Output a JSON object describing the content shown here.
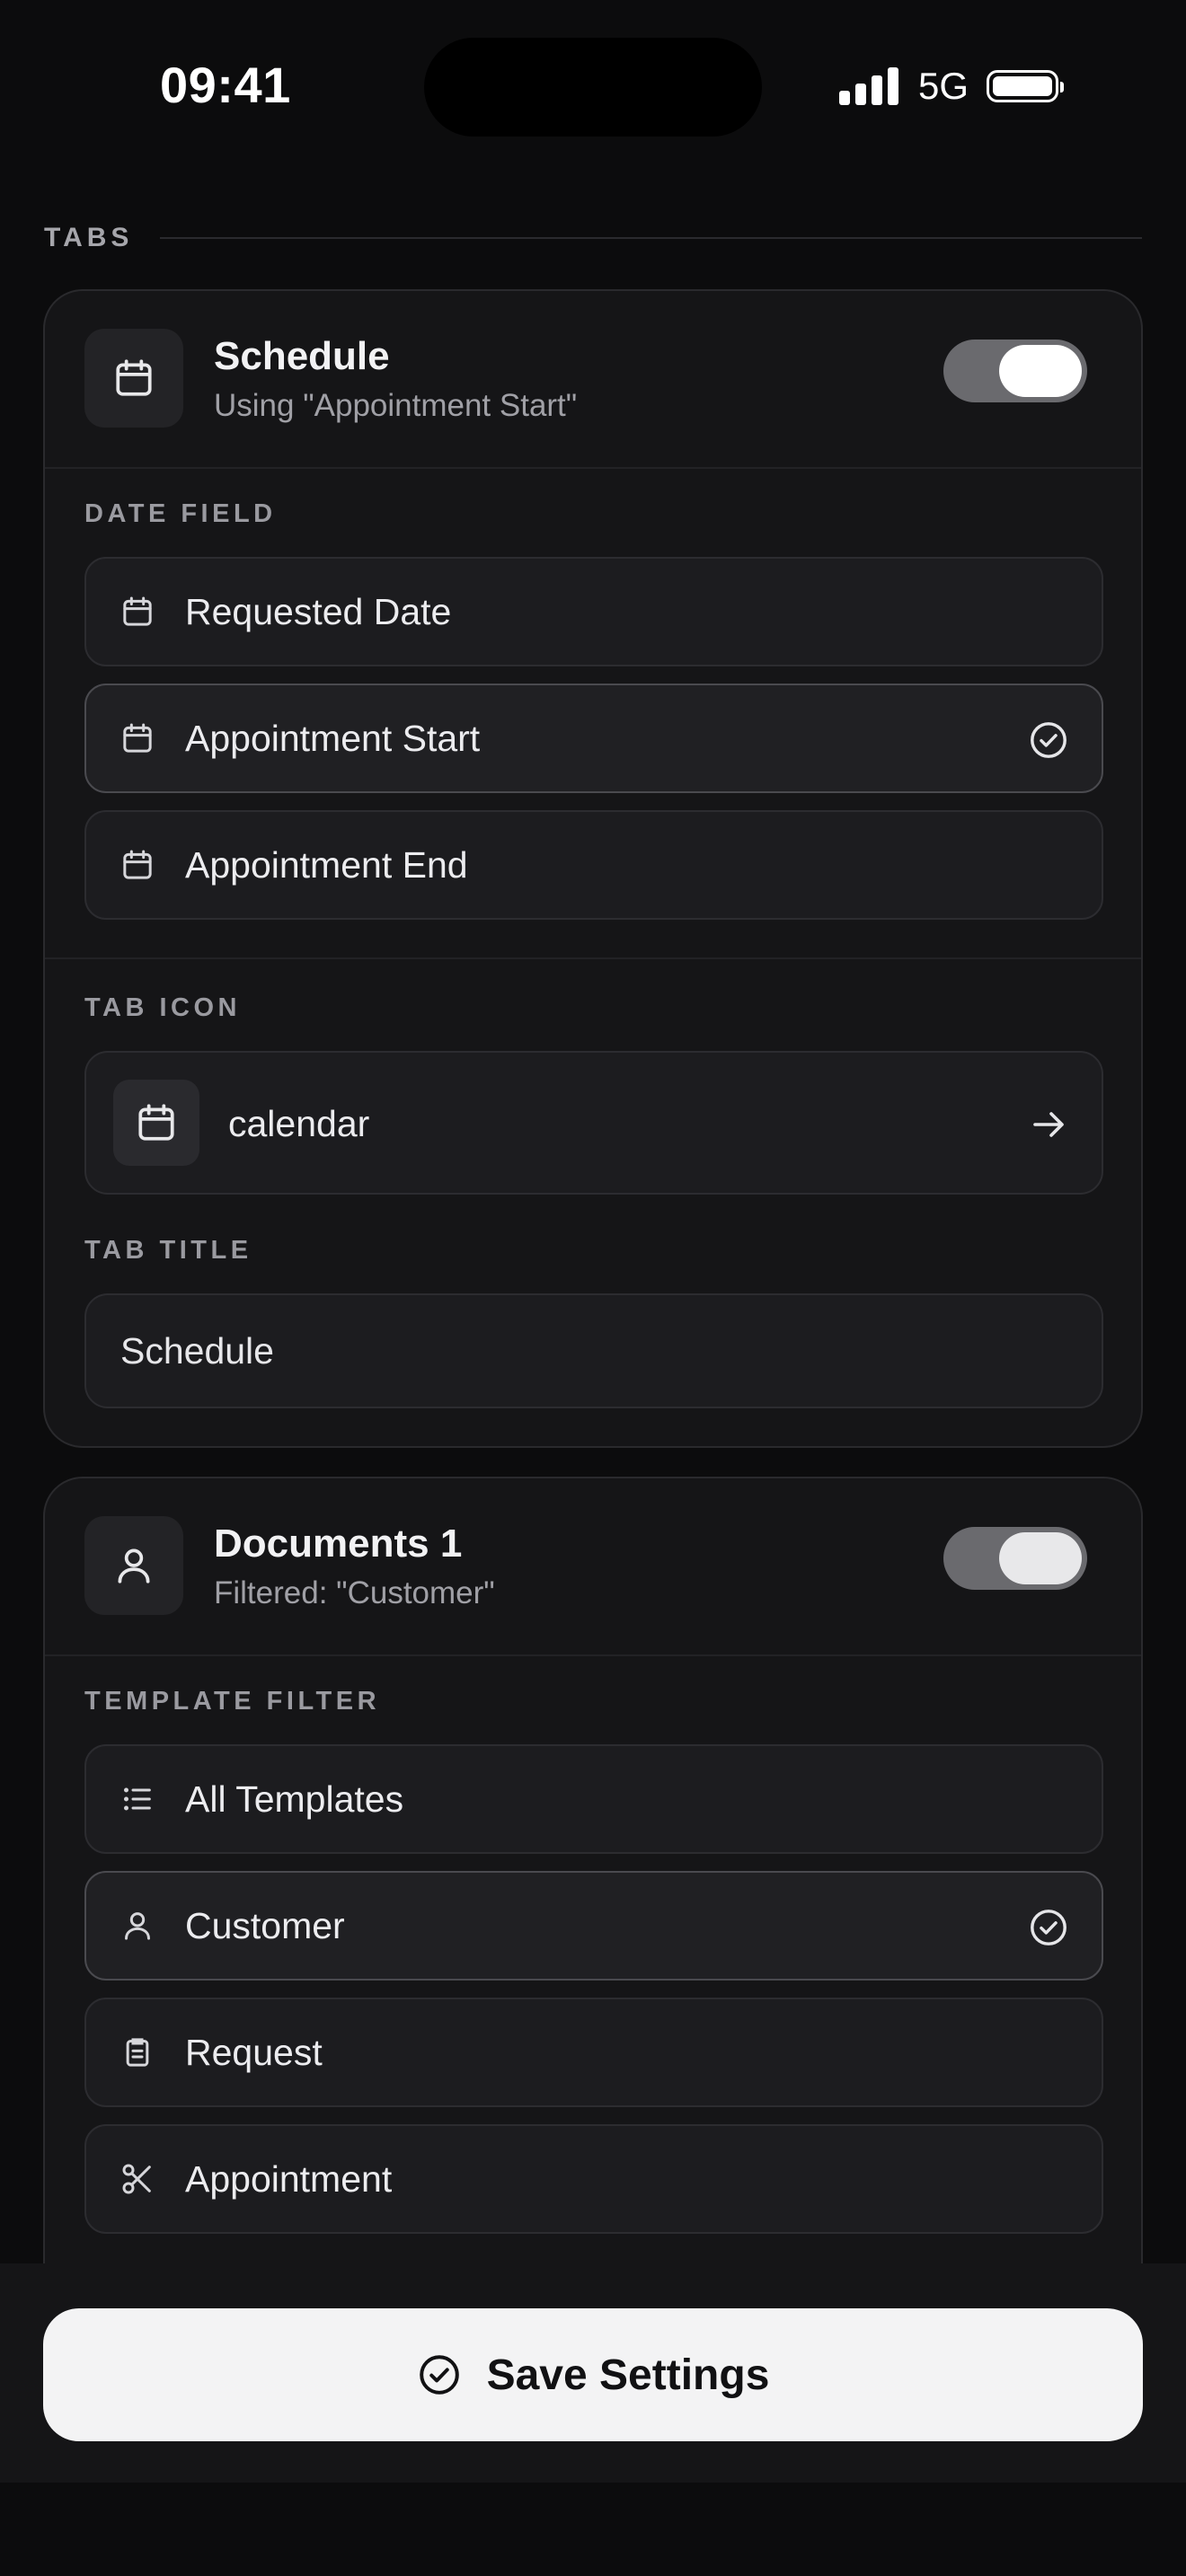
{
  "status": {
    "time": "09:41",
    "network": "5G"
  },
  "section": {
    "label": "TABS"
  },
  "tab1": {
    "title": "Schedule",
    "subtitle": "Using \"Appointment Start\"",
    "enabled": true,
    "date_field_label": "DATE FIELD",
    "date_options": [
      {
        "label": "Requested Date",
        "icon": "calendar-icon",
        "selected": false
      },
      {
        "label": "Appointment Start",
        "icon": "calendar-icon",
        "selected": true
      },
      {
        "label": "Appointment End",
        "icon": "calendar-icon",
        "selected": false
      }
    ],
    "tab_icon_label": "TAB ICON",
    "tab_icon_value": "calendar",
    "tab_title_label": "TAB TITLE",
    "tab_title_value": "Schedule"
  },
  "tab2": {
    "title": "Documents 1",
    "subtitle": "Filtered: \"Customer\"",
    "enabled": true,
    "filter_label": "TEMPLATE FILTER",
    "filter_options": [
      {
        "label": "All Templates",
        "icon": "list-icon",
        "selected": false
      },
      {
        "label": "Customer",
        "icon": "user-icon",
        "selected": true
      },
      {
        "label": "Request",
        "icon": "clipboard-icon",
        "selected": false
      },
      {
        "label": "Appointment",
        "icon": "scissors-icon",
        "selected": false
      }
    ]
  },
  "footer": {
    "save_label": "Save Settings"
  },
  "colors": {
    "background": "#0c0c0d",
    "card": "#151517",
    "button": "#f3f3f4"
  }
}
